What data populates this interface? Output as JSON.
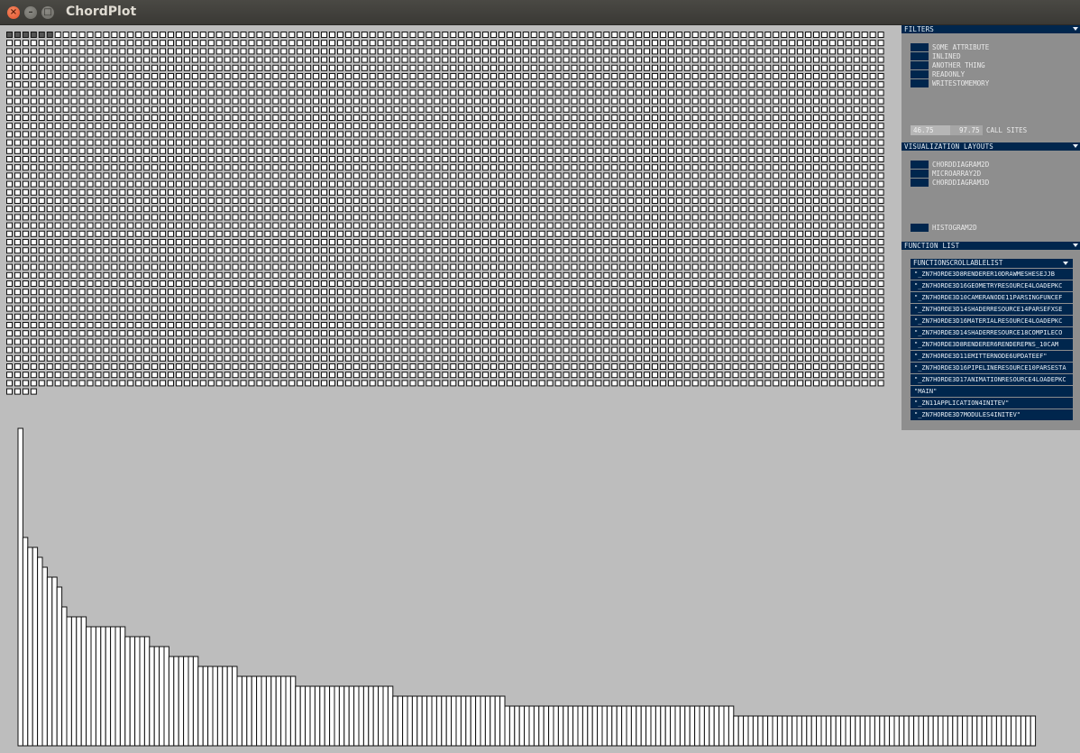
{
  "window": {
    "title": "ChordPlot"
  },
  "filters": {
    "header": "FILTERS",
    "toggles": [
      "SOME ATTRIBUTE",
      "INLINED",
      "ANOTHER THING",
      "READONLY",
      "WRITESTOMEMORY"
    ],
    "range": {
      "low": "46.75",
      "high": "97.75",
      "label": "CALL SITES"
    }
  },
  "layouts": {
    "header": "VISUALIZATION LAYOUTS",
    "toggles": [
      "CHORDDIAGRAM2D",
      "MICROARRAY2D",
      "CHORDDIAGRAM3D"
    ],
    "extra_toggle": "HISTOGRAM2D"
  },
  "function_list": {
    "header": "FUNCTION LIST",
    "dropdown_label": "FUNCTIONSCROLLABLELIST",
    "items": [
      "\"_ZN7HORDE3D8RENDERER10DRAWMESHESEJJB",
      "\"_ZN7HORDE3D16GEOMETRYRESOURCE4LOADEPKC",
      "\"_ZN7HORDE3D10CAMERANODE11PARSINGFUNCEF",
      "\"_ZN7HORDE3D14SHADERRESOURCE14PARSEFXSE",
      "\"_ZN7HORDE3D16MATERIALRESOURCE4LOADEPKC",
      "\"_ZN7HORDE3D14SHADERRESOURCE18COMPILECO",
      "\"_ZN7HORDE3D8RENDERER6RENDEREPNS_10CAM",
      "\"_ZN7HORDE3D11EMITTERNODE6UPDATEEF\"",
      "\"_ZN7HORDE3D16PIPELINERESOURCE10PARSESTA",
      "\"_ZN7HORDE3D17ANIMATIONRESOURCE4LOADEPKC",
      "\"MAIN\"",
      "\"_ZN11APPLICATION4INITEV\"",
      "\"_ZN7HORDE3D7MODULES4INITEV\""
    ]
  },
  "matrix": {
    "columns": 109,
    "rows": 44,
    "partial_last_row": 4
  },
  "histogram": {
    "values": [
      320,
      210,
      200,
      200,
      190,
      180,
      170,
      170,
      160,
      140,
      130,
      130,
      130,
      130,
      120,
      120,
      120,
      120,
      120,
      120,
      120,
      120,
      110,
      110,
      110,
      110,
      110,
      100,
      100,
      100,
      100,
      90,
      90,
      90,
      90,
      90,
      90,
      80,
      80,
      80,
      80,
      80,
      80,
      80,
      80,
      70,
      70,
      70,
      70,
      70,
      70,
      70,
      70,
      70,
      70,
      70,
      70,
      60,
      60,
      60,
      60,
      60,
      60,
      60,
      60,
      60,
      60,
      60,
      60,
      60,
      60,
      60,
      60,
      60,
      60,
      60,
      60,
      50,
      50,
      50,
      50,
      50,
      50,
      50,
      50,
      50,
      50,
      50,
      50,
      50,
      50,
      50,
      50,
      50,
      50,
      50,
      50,
      50,
      50,
      50,
      40,
      40,
      40,
      40,
      40,
      40,
      40,
      40,
      40,
      40,
      40,
      40,
      40,
      40,
      40,
      40,
      40,
      40,
      40,
      40,
      40,
      40,
      40,
      40,
      40,
      40,
      40,
      40,
      40,
      40,
      40,
      40,
      40,
      40,
      40,
      40,
      40,
      40,
      40,
      40,
      40,
      40,
      40,
      40,
      40,
      40,
      40,
      30,
      30,
      30,
      30,
      30,
      30,
      30,
      30,
      30,
      30,
      30,
      30,
      30,
      30,
      30,
      30,
      30,
      30,
      30,
      30,
      30,
      30,
      30,
      30,
      30,
      30,
      30,
      30,
      30,
      30,
      30,
      30,
      30,
      30,
      30,
      30,
      30,
      30,
      30,
      30,
      30,
      30,
      30,
      30,
      30,
      30,
      30,
      30,
      30,
      30,
      30,
      30,
      30,
      30,
      30,
      30,
      30,
      30,
      30,
      30,
      30,
      30
    ]
  },
  "colors": {
    "background": "#bdbdbd",
    "panel": "#8e8e8e",
    "accent": "#00264d"
  }
}
